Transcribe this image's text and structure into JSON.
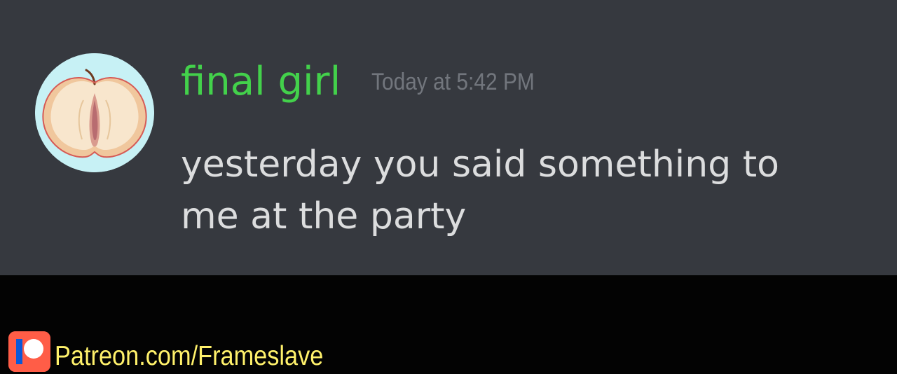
{
  "message": {
    "author": "final girl",
    "timestamp": "Today at 5:42 PM",
    "text": "yesterday you said something to\nme at the party"
  },
  "watermark": {
    "text": "Patreon.com/Frameslave"
  },
  "colors": {
    "panel_background": "#36393f",
    "username": "#43d14b",
    "timestamp": "#72767d",
    "message_text": "#dcddde",
    "watermark_text": "#fff16b",
    "patreon_brand": "#ff5d47"
  },
  "icons": {
    "avatar": "apple-avatar",
    "watermark_logo": "patreon-logo-icon"
  }
}
